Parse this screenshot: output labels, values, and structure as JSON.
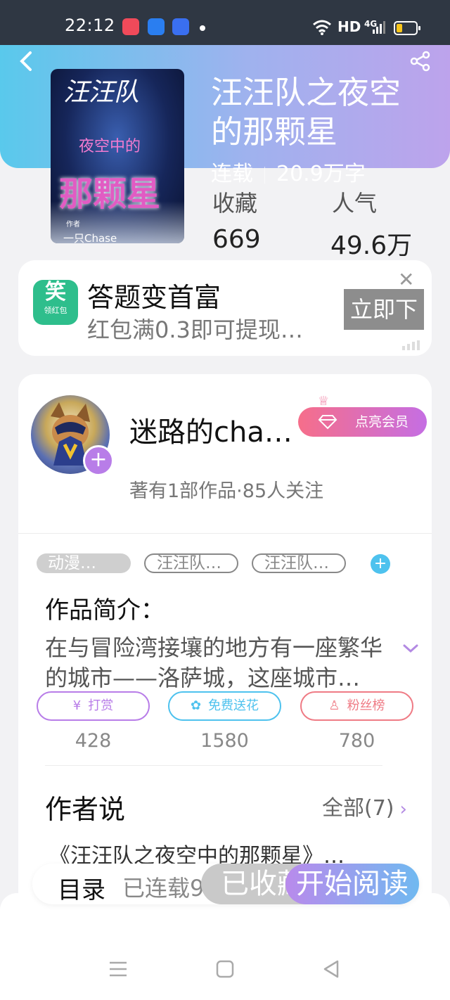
{
  "statusbar": {
    "time": "22:12",
    "hd": "HD",
    "network": "4G"
  },
  "header": {
    "back": "‹",
    "share": "share-icon"
  },
  "book": {
    "title": "汪汪队之夜空的那颗星",
    "status": "连载",
    "words": "20.9万字",
    "favorites_label": "收藏",
    "favorites": "669",
    "popularity_label": "人气",
    "popularity": "49.6万",
    "cover": {
      "line1": "汪汪队",
      "line2": "夜空中的",
      "line3": "那颗星",
      "line4": "作者",
      "line5": "一只Chase"
    }
  },
  "ad": {
    "title": "答题变首富",
    "subtitle": "红包满0.3即可提现…",
    "button": "立即下",
    "icon_label": "领红包"
  },
  "author": {
    "name": "迷路的cha…",
    "vip": "点亮会员",
    "meta": "著有1部作品·85人关注"
  },
  "tags": [
    "动漫…",
    "汪汪队…",
    "汪汪队…"
  ],
  "intro": {
    "heading": "作品简介：",
    "text": "在与冒险湾接壤的地方有一座繁华的城市——洛萨城，这座城市…"
  },
  "actions": [
    {
      "label": "打赏",
      "count": "428",
      "color": "#b87de8",
      "icon": "¥"
    },
    {
      "label": "免费送花",
      "count": "1580",
      "color": "#4ec2ee",
      "icon": "✿"
    },
    {
      "label": "粉丝榜",
      "count": "780",
      "color": "#ef7b85",
      "icon": "♙"
    }
  ],
  "author_says": {
    "heading": "作者说",
    "more": "全部(7)",
    "snippet": "《汪汪队之夜空中的那颗星》…"
  },
  "bottom": {
    "toc": "目录",
    "serial": "已连载9",
    "collected": "已收藏",
    "read": "开始阅读"
  }
}
